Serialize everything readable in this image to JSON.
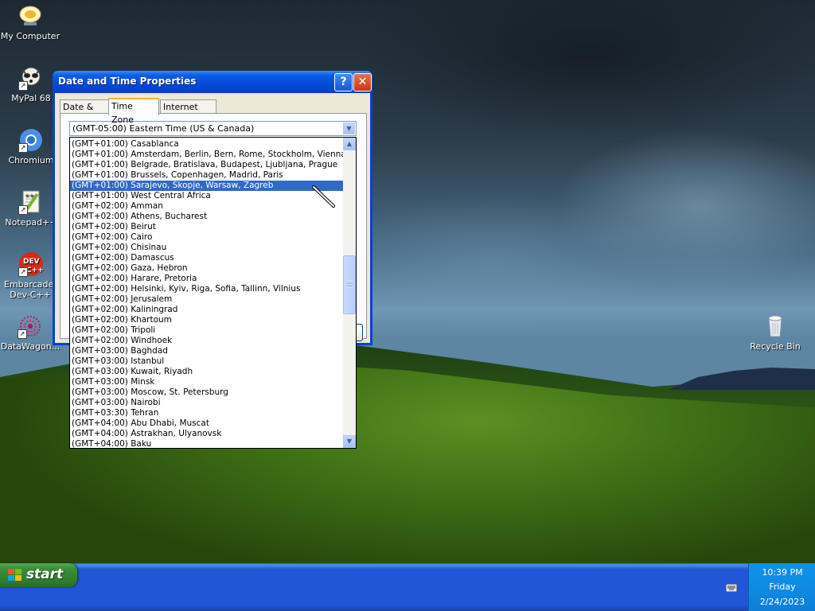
{
  "desktop": {
    "icons": [
      {
        "label": "My Computer"
      },
      {
        "label": "MyPal 68"
      },
      {
        "label": "Chromium"
      },
      {
        "label": "Notepad++"
      },
      {
        "label": "Embarcadero Dev-C++"
      },
      {
        "label": "DataWagon..."
      },
      {
        "label": "Recycle Bin"
      }
    ]
  },
  "dialog": {
    "title": "Date and Time Properties",
    "help_glyph": "?",
    "close_glyph": "✕",
    "tabs": [
      {
        "label": "Date & Time",
        "active": false
      },
      {
        "label": "Time Zone",
        "active": true
      },
      {
        "label": "Internet Time",
        "active": false
      }
    ],
    "timezone_combo": {
      "value": "(GMT-05:00) Eastern Time (US & Canada)",
      "arrow_icon": "chevron-down-icon"
    },
    "timezone_list": {
      "selected_index": 4,
      "items": [
        "(GMT+01:00) Casablanca",
        "(GMT+01:00) Amsterdam, Berlin, Bern, Rome, Stockholm, Vienna",
        "(GMT+01:00) Belgrade, Bratislava, Budapest, Ljubljana, Prague",
        "(GMT+01:00) Brussels, Copenhagen, Madrid, Paris",
        "(GMT+01:00) Sarajevo, Skopje, Warsaw, Zagreb",
        "(GMT+01:00) West Central Africa",
        "(GMT+02:00) Amman",
        "(GMT+02:00) Athens, Bucharest",
        "(GMT+02:00) Beirut",
        "(GMT+02:00) Cairo",
        "(GMT+02:00) Chisinau",
        "(GMT+02:00) Damascus",
        "(GMT+02:00) Gaza, Hebron",
        "(GMT+02:00) Harare, Pretoria",
        "(GMT+02:00) Helsinki, Kyiv, Riga, Sofia, Tallinn, Vilnius",
        "(GMT+02:00) Jerusalem",
        "(GMT+02:00) Kaliningrad",
        "(GMT+02:00) Khartoum",
        "(GMT+02:00) Tripoli",
        "(GMT+02:00) Windhoek",
        "(GMT+03:00) Baghdad",
        "(GMT+03:00) Istanbul",
        "(GMT+03:00) Kuwait, Riyadh",
        "(GMT+03:00) Minsk",
        "(GMT+03:00) Moscow, St. Petersburg",
        "(GMT+03:00) Nairobi",
        "(GMT+03:30) Tehran",
        "(GMT+04:00) Abu Dhabi, Muscat",
        "(GMT+04:00) Astrakhan, Ulyanovsk",
        "(GMT+04:00) Baku"
      ]
    }
  },
  "taskbar": {
    "start_label": "start",
    "clock": {
      "time": "10:39 PM",
      "day": "Friday",
      "date": "2/24/2023"
    }
  },
  "colors": {
    "selection": "#316ac5",
    "titlebar": "#0b5de7",
    "taskbar": "#2157d7",
    "start_button": "#3c8f3c"
  }
}
